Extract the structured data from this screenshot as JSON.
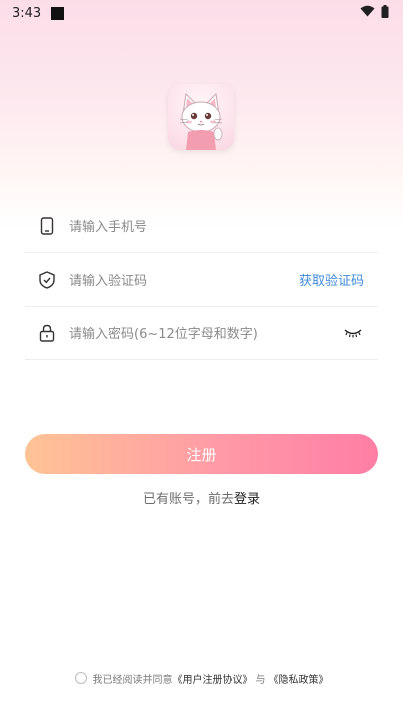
{
  "status_bar": {
    "time": "3:43"
  },
  "form": {
    "phone_placeholder": "请输入手机号",
    "code_placeholder": "请输入验证码",
    "get_code_label": "获取验证码",
    "password_placeholder": "请输入密码(6~12位字母和数字)"
  },
  "actions": {
    "register_label": "注册",
    "have_account_text": "已有账号，前去",
    "login_label": "登录"
  },
  "agreement": {
    "prefix": "我已经阅读并同意",
    "user_agreement": "《用户注册协议》",
    "conjunction": "与",
    "privacy_policy": "《隐私政策》"
  },
  "colors": {
    "accent_link": "#3f8bd8",
    "button_gradient_start": "#ffc394",
    "button_gradient_end": "#ff7ea5"
  },
  "icons": [
    "phone-icon",
    "shield-icon",
    "lock-icon",
    "eye-closed-icon",
    "wifi-icon",
    "battery-icon",
    "cat-logo"
  ]
}
